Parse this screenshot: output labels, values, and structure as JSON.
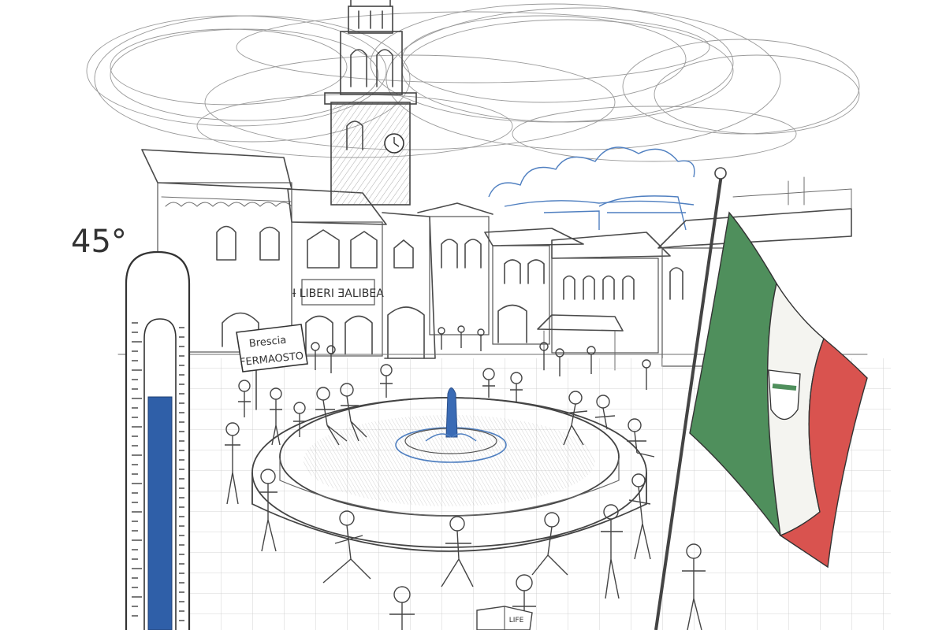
{
  "thermometer": {
    "reading_label": "45°",
    "fill_fraction": 0.8,
    "liquid_color": "#2f5fa8"
  },
  "signs": {
    "protest_line1": "Brescia",
    "protest_line2": "FERMAOSTO",
    "shop_banner": "Ɨ LIBERI ƎALIBEA"
  },
  "newspaper": {
    "headline": "LIFE"
  },
  "flag": {
    "colors": {
      "green": "#4f8f5c",
      "white": "#f4f4f0",
      "red": "#d9534f"
    }
  },
  "sky": {
    "tint": "#4f7fc0"
  }
}
